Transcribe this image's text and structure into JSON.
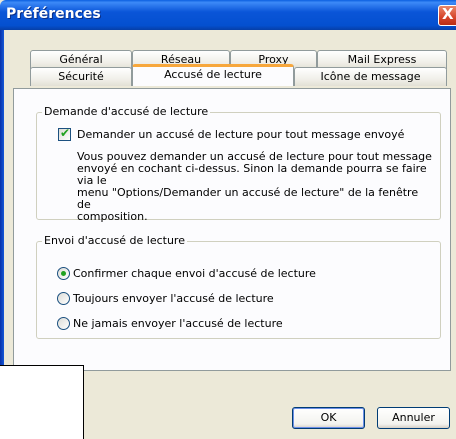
{
  "window": {
    "title": "Préférences",
    "close_glyph": "X"
  },
  "tabs": {
    "row_back": [
      "Général",
      "Réseau",
      "Proxy",
      "Mail Express"
    ],
    "row_front": [
      "Sécurité",
      "Accusé de lecture",
      "Icône de message"
    ],
    "active": "Accusé de lecture"
  },
  "group_request": {
    "title": "Demande d'accusé de lecture",
    "checkbox_label": "Demander un accusé de lecture pour tout message envoyé",
    "checkbox_checked": true,
    "description_lines": [
      "Vous pouvez demander un accusé de lecture pour tout message",
      "envoyé en cochant ci-dessus. Sinon la demande pourra se faire via le",
      "menu \"Options/Demander un accusé de lecture\" de la fenêtre de",
      "composition."
    ]
  },
  "group_send": {
    "title": "Envoi d'accusé de lecture",
    "options": [
      {
        "label": "Confirmer chaque envoi d'accusé de lecture",
        "selected": true
      },
      {
        "label": "Toujours envoyer l'accusé de lecture",
        "selected": false
      },
      {
        "label": "Ne jamais envoyer l'accusé de lecture",
        "selected": false
      }
    ]
  },
  "buttons": {
    "ok": "OK",
    "cancel": "Annuler"
  },
  "colors": {
    "titlebar": "#0a55d8",
    "active_tab_accent": "#f7a73c",
    "check_green": "#21a121"
  }
}
